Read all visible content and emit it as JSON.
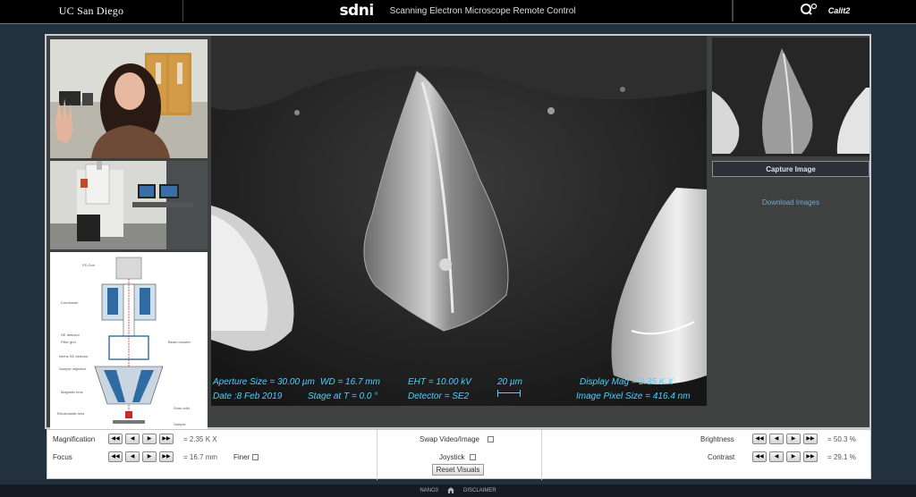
{
  "header": {
    "left_logo": "UC San Diego",
    "center_logo": "sdni",
    "title": "Scanning Electron Microscope Remote Control",
    "right_logo": "Calit2"
  },
  "sem": {
    "aperture": "Aperture Size = 30.00 µm",
    "wd": "WD = 16.7 mm",
    "eht": "EHT = 10.00 kV",
    "scale": "20 µm",
    "display_mag": "Display Mag =  2.35 K X",
    "date": "Date :8 Feb 2019",
    "stage": "Stage at T =  0.0 °",
    "detector": "Detector = SE2",
    "pixel_size": "Image Pixel Size = 416.4 nm"
  },
  "right_panel": {
    "capture_label": "Capture Image",
    "download_label": "Download Images"
  },
  "diagram": {
    "labels": [
      "FE-Gun",
      "Condenser",
      "SE detector",
      "Filter grid",
      "Inlens SE detector",
      "Sample objective",
      "Magnetic lens",
      "Electrostatic lens",
      "Beam booster",
      "Scan coils",
      "Sample"
    ]
  },
  "controls": {
    "magnification_label": "Magnification",
    "magnification_value": "= 2.35 K X",
    "focus_label": "Focus",
    "focus_value": "= 16.7 mm",
    "finer_label": "Finer",
    "swap_label": "Swap Video/Image",
    "joystick_label": "Joystick",
    "reset_label": "Reset Visuals",
    "brightness_label": "Brightness",
    "brightness_value": "= 50.3 %",
    "contrast_label": "Contrast",
    "contrast_value": "= 29.1 %",
    "nav_buttons": [
      "◀◀",
      "◀",
      "▶",
      "▶▶"
    ]
  },
  "footer": {
    "item1": "NANO3",
    "home_icon": "home-icon",
    "item2": "DISCLAIMER"
  }
}
